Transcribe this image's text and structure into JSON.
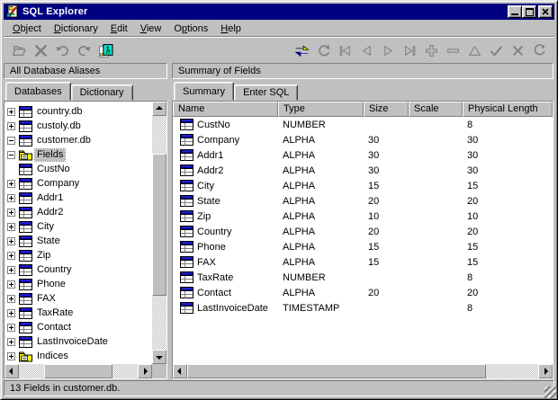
{
  "titlebar": {
    "title": "SQL Explorer",
    "buttons": [
      "minimize",
      "maximize",
      "close"
    ]
  },
  "menu": {
    "items": [
      {
        "pre": "",
        "key": "O",
        "post": "bject"
      },
      {
        "pre": "",
        "key": "D",
        "post": "ictionary"
      },
      {
        "pre": "",
        "key": "E",
        "post": "dit"
      },
      {
        "pre": "",
        "key": "V",
        "post": "iew"
      },
      {
        "pre": "O",
        "key": "p",
        "post": "tions"
      },
      {
        "pre": "",
        "key": "H",
        "post": "elp"
      }
    ]
  },
  "toolbar": {
    "left_icons": [
      "open",
      "delete",
      "undo",
      "redo",
      "enter-sql"
    ],
    "right_icons": [
      "commit",
      "rollback",
      "first",
      "prior",
      "next",
      "last",
      "insert-record",
      "delete-record",
      "edit-record",
      "post-record",
      "cancel-record",
      "refresh"
    ]
  },
  "left_panel": {
    "header": "All Database Aliases",
    "tabs": [
      "Databases",
      "Dictionary"
    ],
    "active_tab": "Databases",
    "tree": [
      {
        "label": "country.db",
        "level": 0,
        "expand": "plus",
        "icon": "table",
        "selected": false
      },
      {
        "label": "custoly.db",
        "level": 0,
        "expand": "plus",
        "icon": "table",
        "selected": false
      },
      {
        "label": "customer.db",
        "level": 0,
        "expand": "minus",
        "icon": "table",
        "selected": false
      },
      {
        "label": "Fields",
        "level": 1,
        "expand": "minus",
        "icon": "folder",
        "selected": true
      },
      {
        "label": "CustNo",
        "level": 2,
        "expand": null,
        "icon": "table",
        "selected": false
      },
      {
        "label": "Company",
        "level": 2,
        "expand": "plus",
        "icon": "table",
        "selected": false
      },
      {
        "label": "Addr1",
        "level": 2,
        "expand": "plus",
        "icon": "table",
        "selected": false
      },
      {
        "label": "Addr2",
        "level": 2,
        "expand": "plus",
        "icon": "table",
        "selected": false
      },
      {
        "label": "City",
        "level": 2,
        "expand": "plus",
        "icon": "table",
        "selected": false
      },
      {
        "label": "State",
        "level": 2,
        "expand": "plus",
        "icon": "table",
        "selected": false
      },
      {
        "label": "Zip",
        "level": 2,
        "expand": "plus",
        "icon": "table",
        "selected": false
      },
      {
        "label": "Country",
        "level": 2,
        "expand": "plus",
        "icon": "table",
        "selected": false
      },
      {
        "label": "Phone",
        "level": 2,
        "expand": "plus",
        "icon": "table",
        "selected": false
      },
      {
        "label": "FAX",
        "level": 2,
        "expand": "plus",
        "icon": "table",
        "selected": false
      },
      {
        "label": "TaxRate",
        "level": 2,
        "expand": "plus",
        "icon": "table",
        "selected": false
      },
      {
        "label": "Contact",
        "level": 2,
        "expand": "plus",
        "icon": "table",
        "selected": false
      },
      {
        "label": "LastInvoiceDate",
        "level": 2,
        "expand": "plus",
        "icon": "table",
        "selected": false
      },
      {
        "label": "Indices",
        "level": 1,
        "expand": "plus",
        "icon": "folder",
        "selected": false
      }
    ]
  },
  "right_panel": {
    "header": "Summary of Fields",
    "tabs": [
      "Summary",
      "Enter SQL"
    ],
    "active_tab": "Summary",
    "table": {
      "columns": [
        "Name",
        "Type",
        "Size",
        "Scale",
        "Physical Length"
      ],
      "rows": [
        {
          "name": "CustNo",
          "type": "NUMBER",
          "size": "",
          "scale": "",
          "physical_length": "8"
        },
        {
          "name": "Company",
          "type": "ALPHA",
          "size": "30",
          "scale": "",
          "physical_length": "30"
        },
        {
          "name": "Addr1",
          "type": "ALPHA",
          "size": "30",
          "scale": "",
          "physical_length": "30"
        },
        {
          "name": "Addr2",
          "type": "ALPHA",
          "size": "30",
          "scale": "",
          "physical_length": "30"
        },
        {
          "name": "City",
          "type": "ALPHA",
          "size": "15",
          "scale": "",
          "physical_length": "15"
        },
        {
          "name": "State",
          "type": "ALPHA",
          "size": "20",
          "scale": "",
          "physical_length": "20"
        },
        {
          "name": "Zip",
          "type": "ALPHA",
          "size": "10",
          "scale": "",
          "physical_length": "10"
        },
        {
          "name": "Country",
          "type": "ALPHA",
          "size": "20",
          "scale": "",
          "physical_length": "20"
        },
        {
          "name": "Phone",
          "type": "ALPHA",
          "size": "15",
          "scale": "",
          "physical_length": "15"
        },
        {
          "name": "FAX",
          "type": "ALPHA",
          "size": "15",
          "scale": "",
          "physical_length": "15"
        },
        {
          "name": "TaxRate",
          "type": "NUMBER",
          "size": "",
          "scale": "",
          "physical_length": "8"
        },
        {
          "name": "Contact",
          "type": "ALPHA",
          "size": "20",
          "scale": "",
          "physical_length": "20"
        },
        {
          "name": "LastInvoiceDate",
          "type": "TIMESTAMP",
          "size": "",
          "scale": "",
          "physical_length": "8"
        }
      ]
    }
  },
  "statusbar": {
    "text": "13 Fields in customer.db."
  },
  "colors": {
    "titlebar": "#000080",
    "titlebar_text": "#ffffff",
    "chrome": "#c0c0c0",
    "panel_bg": "#ffffff",
    "selection_inactive": "#c0c0c0",
    "icon_table_blue": "#0000a8",
    "icon_folder_yellow": "#ffff00",
    "accent_arrow_yellow": "#ffff00",
    "accent_arrow_navy": "#000080",
    "disabled_icon": "#808080"
  }
}
